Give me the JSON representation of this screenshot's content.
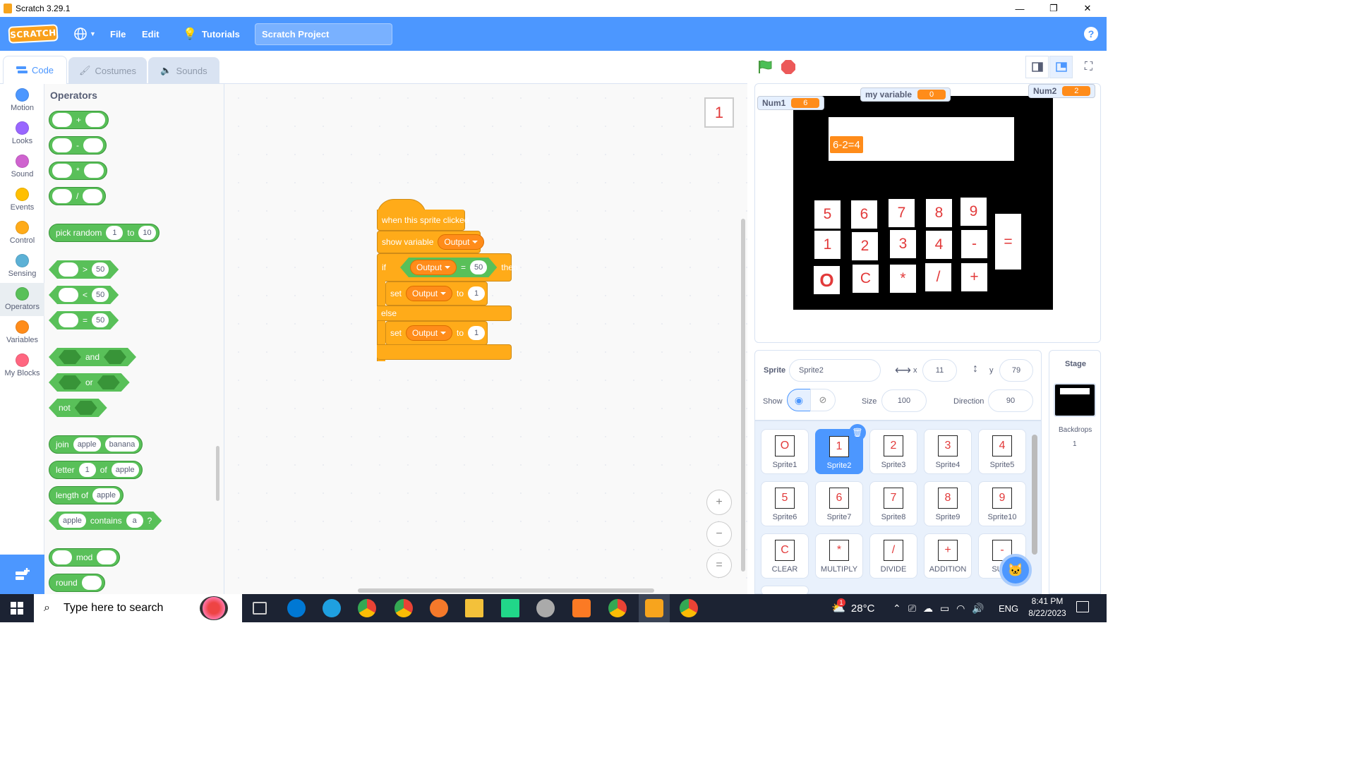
{
  "window": {
    "title": "Scratch 3.29.1",
    "minimize": "—",
    "restore": "❐",
    "close": "✕"
  },
  "menubar": {
    "logo": "SCRATCH",
    "file": "File",
    "edit": "Edit",
    "tutorials": "Tutorials",
    "project_title": "Scratch Project",
    "help": "?"
  },
  "tabs": [
    {
      "label": "Code"
    },
    {
      "label": "Costumes"
    },
    {
      "label": "Sounds"
    }
  ],
  "categories": [
    {
      "label": "Motion",
      "color": "#4c97ff"
    },
    {
      "label": "Looks",
      "color": "#9966ff"
    },
    {
      "label": "Sound",
      "color": "#cf63cf"
    },
    {
      "label": "Events",
      "color": "#ffbf00"
    },
    {
      "label": "Control",
      "color": "#ffab19"
    },
    {
      "label": "Sensing",
      "color": "#5cb1d6"
    },
    {
      "label": "Operators",
      "color": "#59c059"
    },
    {
      "label": "Variables",
      "color": "#ff8c1a"
    },
    {
      "label": "My Blocks",
      "color": "#ff6680"
    }
  ],
  "palette": {
    "title": "Operators",
    "ops": [
      "+",
      "-",
      "*",
      "/"
    ],
    "pick_random": {
      "label": "pick random",
      "from": "1",
      "to_label": "to",
      "to": "10"
    },
    "compare": [
      {
        "op": ">",
        "val": "50"
      },
      {
        "op": "<",
        "val": "50"
      },
      {
        "op": "=",
        "val": "50"
      }
    ],
    "logic": {
      "and": "and",
      "or": "or",
      "not": "not"
    },
    "join": {
      "label": "join",
      "a": "apple",
      "b": "banana"
    },
    "letter": {
      "label": "letter",
      "n": "1",
      "of": "of",
      "word": "apple"
    },
    "length": {
      "label": "length of",
      "word": "apple"
    },
    "contains": {
      "a": "apple",
      "label": "contains",
      "b": "a",
      "q": "?"
    },
    "mod": "mod",
    "round": "round"
  },
  "code": {
    "sprite_badge": "1",
    "script": {
      "hat": "when this sprite clicked",
      "show_variable": "show variable",
      "show_var_name": "Output",
      "if": "if",
      "cond_var": "Output",
      "cond_op": "=",
      "cond_val": "50",
      "then": "then",
      "set1": {
        "label": "set",
        "var": "Output",
        "to": "to",
        "val": "1"
      },
      "else": "else",
      "set2": {
        "label": "set",
        "var": "Output",
        "to": "to",
        "val": "1"
      }
    },
    "zoom_in": "+",
    "zoom_out": "−",
    "zoom_reset": "="
  },
  "stage": {
    "monitors": [
      {
        "name": "Num1",
        "value": "6"
      },
      {
        "name": "my variable",
        "value": "0"
      },
      {
        "name": "Num2",
        "value": "2"
      }
    ],
    "output": "6-2=4",
    "keys": {
      "row1": [
        "5",
        "6",
        "7",
        "8",
        "9"
      ],
      "row2": [
        "1",
        "2",
        "3",
        "4",
        "-"
      ],
      "row3": [
        "O",
        "C",
        "*",
        "/",
        "+"
      ],
      "equals": "="
    }
  },
  "sprite_info": {
    "sprite_label": "Sprite",
    "sprite_name": "Sprite2",
    "x_label": "x",
    "x": "11",
    "y_label": "y",
    "y": "79",
    "show_label": "Show",
    "size_label": "Size",
    "size": "100",
    "direction_label": "Direction",
    "direction": "90"
  },
  "sprites": [
    {
      "name": "Sprite1",
      "glyph": "O"
    },
    {
      "name": "Sprite2",
      "glyph": "1"
    },
    {
      "name": "Sprite3",
      "glyph": "2"
    },
    {
      "name": "Sprite4",
      "glyph": "3"
    },
    {
      "name": "Sprite5",
      "glyph": "4"
    },
    {
      "name": "Sprite6",
      "glyph": "5"
    },
    {
      "name": "Sprite7",
      "glyph": "6"
    },
    {
      "name": "Sprite8",
      "glyph": "7"
    },
    {
      "name": "Sprite9",
      "glyph": "8"
    },
    {
      "name": "Sprite10",
      "glyph": "9"
    },
    {
      "name": "CLEAR",
      "glyph": "C"
    },
    {
      "name": "MULTIPLY",
      "glyph": "*"
    },
    {
      "name": "DIVIDE",
      "glyph": "/"
    },
    {
      "name": "ADDITION",
      "glyph": "+"
    },
    {
      "name": "SUBT",
      "glyph": "-"
    }
  ],
  "stage_panel": {
    "title": "Stage",
    "backdrops_label": "Backdrops",
    "backdrops_count": "1"
  },
  "taskbar": {
    "search": "Type here to search",
    "weather": "28°C",
    "lang": "ENG",
    "time": "8:41 PM",
    "date": "8/22/2023",
    "notif": "1"
  }
}
